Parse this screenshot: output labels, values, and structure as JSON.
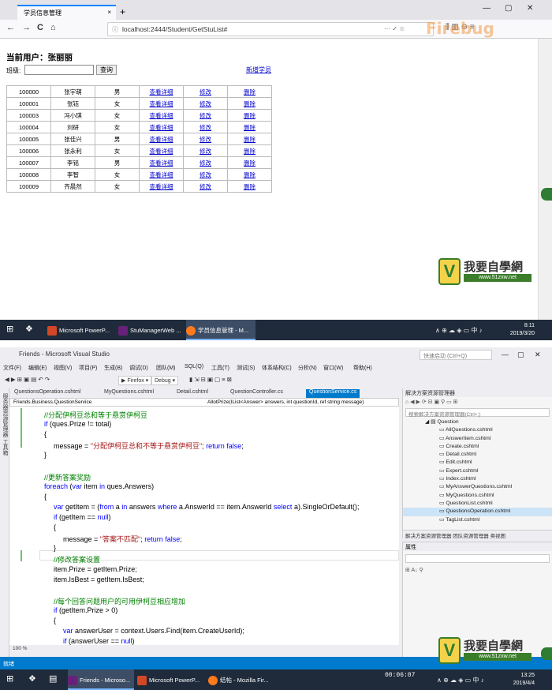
{
  "browser": {
    "tab_title": "学员信息管理",
    "tab_close": "×",
    "new_tab": "+",
    "back": "←",
    "forward": "→",
    "reload": "C",
    "home": "⌂",
    "url": "localhost:2444/Student/GetStuList#",
    "url_dots": "··· ✓ ☆",
    "watermark": "Firebug",
    "minimize": "—",
    "maximize": "▢",
    "close": "✕",
    "toolbar_icons": "⫼ ▥ ⊖ ≡"
  },
  "page": {
    "current_user_label": "当前用户：张丽丽",
    "class_label": "班级:",
    "class_input_value": "",
    "search_button": "查询",
    "add_student_link": "新增学员",
    "students": [
      {
        "id": "100000",
        "name": "张宇萌",
        "sex": "男",
        "detail": "查看详细",
        "edit": "修改",
        "delete": "删除"
      },
      {
        "id": "100001",
        "name": "张钰",
        "sex": "女",
        "detail": "查看详细",
        "edit": "修改",
        "delete": "删除"
      },
      {
        "id": "100003",
        "name": "冯小琪",
        "sex": "女",
        "detail": "查看详细",
        "edit": "修改",
        "delete": "删除"
      },
      {
        "id": "100004",
        "name": "刘研",
        "sex": "女",
        "detail": "查看详细",
        "edit": "修改",
        "delete": "删除"
      },
      {
        "id": "100005",
        "name": "张佳兴",
        "sex": "男",
        "detail": "查看详细",
        "edit": "修改",
        "delete": "删除"
      },
      {
        "id": "100006",
        "name": "张永利",
        "sex": "女",
        "detail": "查看详细",
        "edit": "修改",
        "delete": "删除"
      },
      {
        "id": "100007",
        "name": "李铭",
        "sex": "男",
        "detail": "查看详细",
        "edit": "修改",
        "delete": "删除"
      },
      {
        "id": "100008",
        "name": "李智",
        "sex": "女",
        "detail": "查看详细",
        "edit": "修改",
        "delete": "删除"
      },
      {
        "id": "100009",
        "name": "齐晨然",
        "sex": "女",
        "detail": "查看详细",
        "edit": "修改",
        "delete": "删除"
      }
    ]
  },
  "logo": {
    "mark": "V",
    "title": "我要自學網",
    "site": "www.51zxw.net"
  },
  "taskbar_top": {
    "items": [
      "Microsoft PowerP...",
      "StuManagerWeb ...",
      "学员信息管理 - M..."
    ],
    "clock_time": "8:11",
    "clock_date": "2019/3/20",
    "tray": "∧ ⊕ ☁ ◈ ▭ 中 ♪"
  },
  "vs": {
    "title": "Friends - Microsoft Visual Studio",
    "quick_launch": "快速启动 (Ctrl+Q)",
    "menu": [
      "文件(F)",
      "编辑(E)",
      "视图(V)",
      "项目(P)",
      "生成(B)",
      "调试(D)",
      "团队(M)",
      "SQL(Q)",
      "工具(T)",
      "测试(S)",
      "体系结构(C)",
      "分析(N)",
      "窗口(W)",
      "帮助(H)"
    ],
    "toolbar_browser": "▶ Firefox ▾",
    "toolbar_config": "Debug ▾",
    "left_tabs": "服务器资源管理器  工具箱",
    "doc_tabs": [
      "QuestionsOperation.cshtml",
      "MyQuestions.cshtml",
      "Detail.cshtml",
      "QuestionController.cs",
      "QuestionService.cs"
    ],
    "nav_left": "Friends.Business.QuestionService",
    "nav_right": "AllotPrize(IList<Answer> answers, int questionId, ref string message)",
    "zoom": "100 %",
    "status": "就绪",
    "solution_explorer": {
      "title": "解决方案资源管理器",
      "search": "搜索解决方案资源管理器(Ctrl+;)",
      "folder": "Question",
      "files": [
        "AllQuestions.cshtml",
        "AnswerItem.cshtml",
        "Create.cshtml",
        "Detail.cshtml",
        "Edit.cshtml",
        "Expert.cshtml",
        "Index.cshtml",
        "MyAnswerQuestions.cshtml",
        "MyQuestions.cshtml",
        "QuestionList.cshtml",
        "QuestionsOperation.cshtml",
        "TagList.cshtml"
      ],
      "selected_index": 10,
      "bottom_tabs": "解决方案资源管理器  团队资源管理器  类视图"
    },
    "properties": {
      "title": "属性",
      "tools": "⊞ A↓ ⚲"
    }
  },
  "code": [
    {
      "indent": 1,
      "parts": [
        [
          "cm",
          "//分配伊柯豆总和等于悬赏伊柯豆"
        ]
      ]
    },
    {
      "indent": 1,
      "parts": [
        [
          "kw",
          "if"
        ],
        [
          "",
          " (ques.Prize != total)"
        ]
      ]
    },
    {
      "indent": 1,
      "parts": [
        [
          "",
          "{"
        ]
      ]
    },
    {
      "indent": 2,
      "parts": [
        [
          "",
          "message = "
        ],
        [
          "st",
          "\"分配伊柯豆总和不等于悬赏伊柯豆\""
        ],
        [
          "",
          "; "
        ],
        [
          "kw",
          "return false"
        ],
        [
          "",
          ";"
        ]
      ]
    },
    {
      "indent": 1,
      "parts": [
        [
          "",
          "}"
        ]
      ]
    },
    {
      "indent": 0,
      "parts": [
        [
          "",
          ""
        ]
      ]
    },
    {
      "indent": 1,
      "parts": [
        [
          "cm",
          "//更新答案奖励"
        ]
      ]
    },
    {
      "indent": 1,
      "parts": [
        [
          "kw",
          "foreach"
        ],
        [
          "",
          " ("
        ],
        [
          "kw",
          "var"
        ],
        [
          "",
          " item "
        ],
        [
          "kw",
          "in"
        ],
        [
          "",
          " ques.Answers)"
        ]
      ]
    },
    {
      "indent": 1,
      "parts": [
        [
          "",
          "{"
        ]
      ]
    },
    {
      "indent": 2,
      "parts": [
        [
          "kw",
          "var"
        ],
        [
          "",
          " getItem = ("
        ],
        [
          "kw",
          "from"
        ],
        [
          "",
          " a "
        ],
        [
          "kw",
          "in"
        ],
        [
          "",
          " answers "
        ],
        [
          "kw",
          "where"
        ],
        [
          "",
          " a.AnswerId == item.AnswerId "
        ],
        [
          "kw",
          "select"
        ],
        [
          "",
          " a).SingleOrDefault();"
        ]
      ]
    },
    {
      "indent": 2,
      "parts": [
        [
          "kw",
          "if"
        ],
        [
          "",
          " (getItem == "
        ],
        [
          "kw",
          "null"
        ],
        [
          "",
          ")"
        ]
      ]
    },
    {
      "indent": 2,
      "parts": [
        [
          "",
          "{"
        ]
      ]
    },
    {
      "indent": 3,
      "parts": [
        [
          "",
          "message = "
        ],
        [
          "st",
          "\"答案不匹配\""
        ],
        [
          "",
          "; "
        ],
        [
          "kw",
          "return false"
        ],
        [
          "",
          ";"
        ]
      ]
    },
    {
      "indent": 2,
      "parts": [
        [
          "",
          "}"
        ]
      ]
    },
    {
      "indent": 2,
      "parts": [
        [
          "cm",
          "//修改答案设置"
        ]
      ]
    },
    {
      "indent": 2,
      "parts": [
        [
          "",
          "item.Prize = getItem.Prize;"
        ]
      ]
    },
    {
      "indent": 2,
      "parts": [
        [
          "",
          "item.IsBest = getItem.IsBest;"
        ]
      ]
    },
    {
      "indent": 0,
      "parts": [
        [
          "",
          ""
        ]
      ]
    },
    {
      "indent": 2,
      "parts": [
        [
          "cm",
          "//每个回答问题用户的可用伊柯豆相应增加"
        ]
      ]
    },
    {
      "indent": 2,
      "parts": [
        [
          "kw",
          "if"
        ],
        [
          "",
          " (getItem.Prize > 0)"
        ]
      ]
    },
    {
      "indent": 2,
      "parts": [
        [
          "",
          "{"
        ]
      ]
    },
    {
      "indent": 3,
      "parts": [
        [
          "kw",
          "var"
        ],
        [
          "",
          " answerUser = context.Users.Find(item.CreateUserId);"
        ]
      ]
    },
    {
      "indent": 3,
      "parts": [
        [
          "kw",
          "if"
        ],
        [
          "",
          " (answerUser == "
        ],
        [
          "kw",
          "null"
        ],
        [
          "",
          ")"
        ]
      ]
    }
  ],
  "taskbar_bottom": {
    "items": [
      "Friends - Microso...",
      "Microsoft PowerP...",
      "结帖 - Mozilla Fir..."
    ],
    "timer": "00:06:07",
    "clock_time": "13:25",
    "clock_date": "2019/4/4",
    "tray": "∧ ⊕ ☁ ◈ ▭ 中 ♪"
  },
  "colors": {
    "accent": "#007acc",
    "taskbar": "#1f2b3b",
    "link": "#0000cc",
    "keyword": "#0000ff",
    "comment": "#008000",
    "string": "#a31515"
  }
}
